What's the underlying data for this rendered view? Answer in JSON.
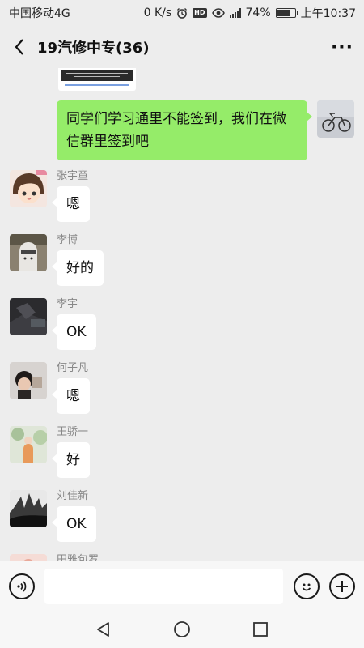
{
  "status_bar": {
    "carrier": "中国移动4G",
    "net_speed": "0 K/s",
    "hd_label": "HD",
    "battery_percent": "74%",
    "battery_level": 0.74,
    "time": "上午10:37"
  },
  "header": {
    "title": "19汽修中专(36)",
    "more_label": "···"
  },
  "self_message": {
    "text": "同学们学习通里不能签到，我们在微信群里签到吧"
  },
  "messages": [
    {
      "sender": "张宇童",
      "text": "嗯"
    },
    {
      "sender": "李博",
      "text": "好的"
    },
    {
      "sender": "李宇",
      "text": "OK"
    },
    {
      "sender": "何子凡",
      "text": "嗯"
    },
    {
      "sender": "王骄一",
      "text": "好"
    },
    {
      "sender": "刘佳新",
      "text": "OK"
    }
  ],
  "partial_sender": "田雅包罗",
  "input": {
    "placeholder": "",
    "value": ""
  },
  "colors": {
    "self_bubble": "#95ec69",
    "background": "#ededed"
  }
}
